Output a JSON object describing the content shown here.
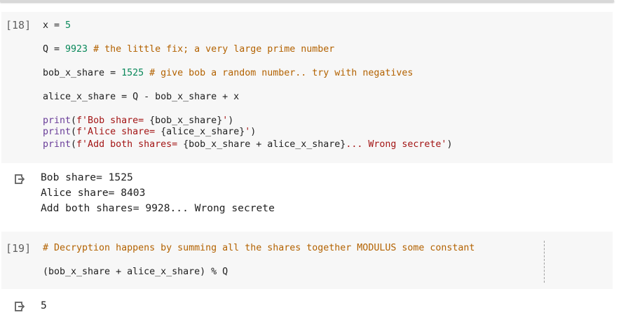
{
  "cell1": {
    "label": "[18]",
    "lines": [
      [
        {
          "t": "x = ",
          "c": "plain"
        },
        {
          "t": "5",
          "c": "num"
        }
      ],
      [
        {
          "t": "Q = ",
          "c": "plain"
        },
        {
          "t": "9923",
          "c": "num"
        },
        {
          "t": " # the little fix; a very large prime number",
          "c": "cmt"
        }
      ],
      [
        {
          "t": "bob_x_share = ",
          "c": "plain"
        },
        {
          "t": "1525",
          "c": "num"
        },
        {
          "t": " # give bob a random number.. try with negatives",
          "c": "cmt"
        }
      ],
      [
        {
          "t": "alice_x_share = Q - bob_x_share + x",
          "c": "plain"
        }
      ],
      [
        {
          "t": "print",
          "c": "kw"
        },
        {
          "t": "(",
          "c": "plain"
        },
        {
          "t": "f'Bob share= ",
          "c": "str"
        },
        {
          "t": "{bob_x_share}",
          "c": "plain"
        },
        {
          "t": "'",
          "c": "str"
        },
        {
          "t": ")",
          "c": "plain"
        }
      ],
      [
        {
          "t": "print",
          "c": "kw"
        },
        {
          "t": "(",
          "c": "plain"
        },
        {
          "t": "f'Alice share= ",
          "c": "str"
        },
        {
          "t": "{alice_x_share}",
          "c": "plain"
        },
        {
          "t": "'",
          "c": "str"
        },
        {
          "t": ")",
          "c": "plain"
        }
      ],
      [
        {
          "t": "print",
          "c": "kw"
        },
        {
          "t": "(",
          "c": "plain"
        },
        {
          "t": "f'Add both shares= ",
          "c": "str"
        },
        {
          "t": "{bob_x_share + alice_x_share}",
          "c": "plain"
        },
        {
          "t": "... Wrong secrete'",
          "c": "str"
        },
        {
          "t": ")",
          "c": "plain"
        }
      ]
    ]
  },
  "output1": {
    "lines": [
      "Bob share= 1525",
      "Alice share= 8403",
      "Add both shares= 9928... Wrong secrete"
    ]
  },
  "cell2": {
    "label": "[19]",
    "lines": [
      [
        {
          "t": "# Decryption happens by summing all the shares together MODULUS some constant",
          "c": "cmt"
        }
      ],
      [
        {
          "t": "(bob_x_share + alice_x_share) % Q",
          "c": "plain"
        }
      ]
    ]
  },
  "output2": {
    "lines": [
      "5"
    ]
  }
}
